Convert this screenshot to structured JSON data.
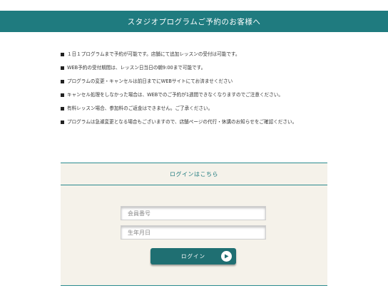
{
  "header": {
    "title": "スタジオプログラムご予約のお客様へ"
  },
  "notices": [
    "１日１プログラムまで予約が可能です。店舗にて追加レッスンの受付は可能です。",
    "WEB予約の受付期間は、レッスン日当日の朝9:00まで可能です。",
    "プログラムの変更・キャンセルは前日までにWEBサイトにてお済ませください",
    "キャンセル処理をしなかった場合は、WEBでのご予約が1週間できなくなりますのでご注意ください。",
    "有料レッスン場合、参加料のご返金はできません。ご了承ください。",
    "プログラムは急遽変更となる場合もございますので、店舗ページの代行・休講のお知らせをご確認ください。"
  ],
  "login": {
    "heading": "ログインはこちら",
    "member_placeholder": "会員番号",
    "birth_placeholder": "生年月日",
    "button_label": "ログイン",
    "button_icon": "play-circle-icon"
  },
  "colors": {
    "accent": "#1f7b7f",
    "panel_bg": "#f5f2ea"
  }
}
